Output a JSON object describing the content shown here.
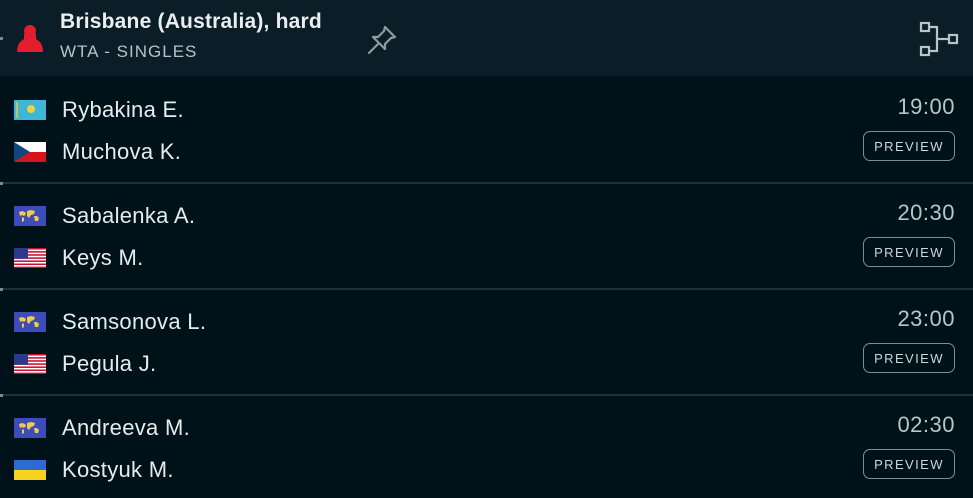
{
  "tournament": {
    "title": "Brisbane (Australia), hard",
    "subtitle": "WTA - SINGLES",
    "icon": "female-player-icon",
    "actions": [
      "pin-icon",
      "draw-bracket-icon"
    ]
  },
  "colors": {
    "background": "#001219",
    "header": "#0b1e27",
    "accent_red": "#e11d2e"
  },
  "matches": [
    {
      "time": "19:00",
      "preview_label": "PREVIEW",
      "players": [
        {
          "name": "Rybakina E.",
          "flag": "kazakhstan-flag"
        },
        {
          "name": "Muchova K.",
          "flag": "czech-flag"
        }
      ]
    },
    {
      "time": "20:30",
      "preview_label": "PREVIEW",
      "players": [
        {
          "name": "Sabalenka A.",
          "flag": "world-flag"
        },
        {
          "name": "Keys M.",
          "flag": "usa-flag"
        }
      ]
    },
    {
      "time": "23:00",
      "preview_label": "PREVIEW",
      "players": [
        {
          "name": "Samsonova L.",
          "flag": "world-flag"
        },
        {
          "name": "Pegula J.",
          "flag": "usa-flag"
        }
      ]
    },
    {
      "time": "02:30",
      "preview_label": "PREVIEW",
      "players": [
        {
          "name": "Andreeva M.",
          "flag": "world-flag"
        },
        {
          "name": "Kostyuk M.",
          "flag": "ukraine-flag"
        }
      ]
    }
  ]
}
